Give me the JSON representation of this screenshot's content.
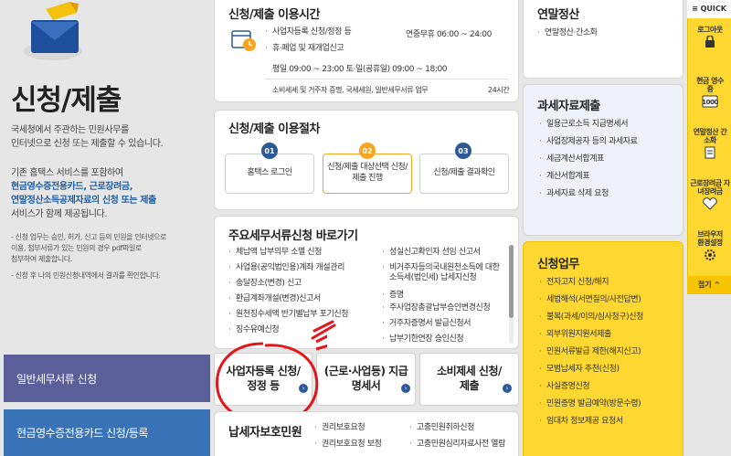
{
  "left": {
    "title": "신청/제출",
    "intro": [
      "국세청에서 주관하는 민원사무를",
      "인터넷으로 신청 또는 제출할 수 있습니다."
    ],
    "info1": [
      "기존 홈택스 서비스를 포함하여",
      "현금영수증전용카드, 근로장려금,",
      "연말정산소득공제자료의 신청 또는 제출",
      "서비스가 함께 제공됩니다."
    ],
    "notes": [
      "- 신청 업무는 승인, 허가, 신고 등의 민원을 인터넷으로",
      "  이용, 첨부서류가 있는 민원의 경우 pdf파일로",
      "  첨부하여 제출합니다.",
      "- 신청 후 나의 민원신청내역에서 결과를 확인합니다."
    ],
    "nav": [
      "일반세무서류 신청",
      "현금영수증전용카드 신청/등록"
    ]
  },
  "hours": {
    "title": "신청/제출 이용시간",
    "rows": [
      {
        "label": "사업자등록 신청/정정 등",
        "value": "연중무휴 06:00 ~ 24:00"
      },
      {
        "label": "휴·폐업 및 재개업신고",
        "value": ""
      },
      {
        "label": "평일 09:00 ~ 23:00 토·일(공휴일) 09:00 ~ 18:00",
        "value": ""
      },
      {
        "label": "소비세세 및 거주자 증명, 국세세원, 일반세무서류 업무",
        "value": "24시간"
      }
    ]
  },
  "procedure": {
    "title": "신청/제출 이용절차",
    "steps": [
      {
        "num": "01",
        "label": "홈택스 로그인"
      },
      {
        "num": "02",
        "label": "신청/제출 대상선택 신청/제출 진행"
      },
      {
        "num": "03",
        "label": "신청/제출 결과확인"
      }
    ]
  },
  "shortcuts": {
    "title": "주요세무서류신청 바로가기",
    "col1": [
      "체납액 납부의무 소멸 신청",
      "사업용(공익법인용)계좌 개설관리",
      "송달장소(변경) 신고",
      "환급계좌개설(변경)신고서",
      "원천징수세액 반기별납부 포기신청",
      "징수유예신청"
    ],
    "col2": [
      "성실신고확인자 선임 신고서",
      "비거주자등의국내원천소득에 대한 소득세(법인세) 납세지신청",
      "증명",
      "주사업장총괄납부승인변경신청",
      "거주자증명서 발급신청서",
      "납부기한연장 승인신청"
    ]
  },
  "bigbuttons": [
    "사업자등록 신청/정정 등",
    "(근로·사업등) 지급명세서",
    "소비제세 신청/제출"
  ],
  "protection": {
    "title": "납세자보호민원",
    "col1": [
      "권리보호요청",
      "권리보호요청 보정"
    ],
    "col2": [
      "고충민원취하신청",
      "고충민원심리자료사전 열람"
    ]
  },
  "yearend": {
    "title": "연말정산",
    "items": [
      "연말정산·간소화"
    ]
  },
  "taxdata": {
    "title": "과세자료제출",
    "items": [
      "일용근로소득 지급명세서",
      "사업장제공자 등의 과세자료",
      "세금계산서합계표",
      "계산서합계표",
      "과세자료 삭제 요청"
    ]
  },
  "apply": {
    "title": "신청업무",
    "items": [
      "전자고지 신청/해지",
      "세법해석(서면질의/사전답변)",
      "불복(과세/이의/심사청구)신청",
      "외부위원지원서제출",
      "민원서류발급 제한(해지신고)",
      "모범납세자 추천(신청)",
      "사실증명신청",
      "민원증명 발급예약(방문수령)",
      "임대차 정보제공 요청서"
    ]
  },
  "quick": {
    "header": "≡ QUICK",
    "items": [
      "로그아웃",
      "현금 영수증",
      "연말정산 간소화",
      "근로장려금 자녀장려금",
      "브라우저 환경설정"
    ],
    "close": "접기 ^"
  },
  "colors": {
    "navy": "#5a5f9a",
    "blue": "#3a72b7",
    "accent": "#f7a520",
    "yellow": "#fed731",
    "badge": "#2d5a97"
  }
}
